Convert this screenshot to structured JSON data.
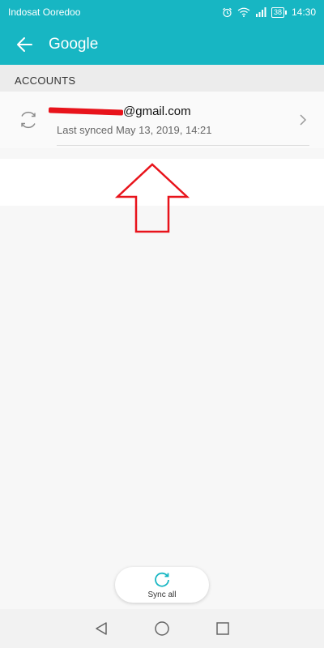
{
  "status_bar": {
    "carrier": "Indosat Ooredoo",
    "battery": "38",
    "time": "14:30"
  },
  "app_bar": {
    "title": "Google"
  },
  "accounts_section": {
    "header": "ACCOUNTS",
    "items": [
      {
        "email": "@gmail.com",
        "sync_status": "Last synced May 13, 2019, 14:21"
      }
    ]
  },
  "sync_all": {
    "label": "Sync all"
  },
  "colors": {
    "accent": "#17b6c3",
    "annotation_red": "#e8131b"
  },
  "icons": {
    "back": "arrow-left-icon",
    "account_sync": "sync-icon",
    "chevron": "chevron-right-icon",
    "sync_all": "sync-all-icon",
    "nav_back": "triangle-back-icon",
    "nav_home": "circle-home-icon",
    "nav_recents": "square-recents-icon"
  }
}
